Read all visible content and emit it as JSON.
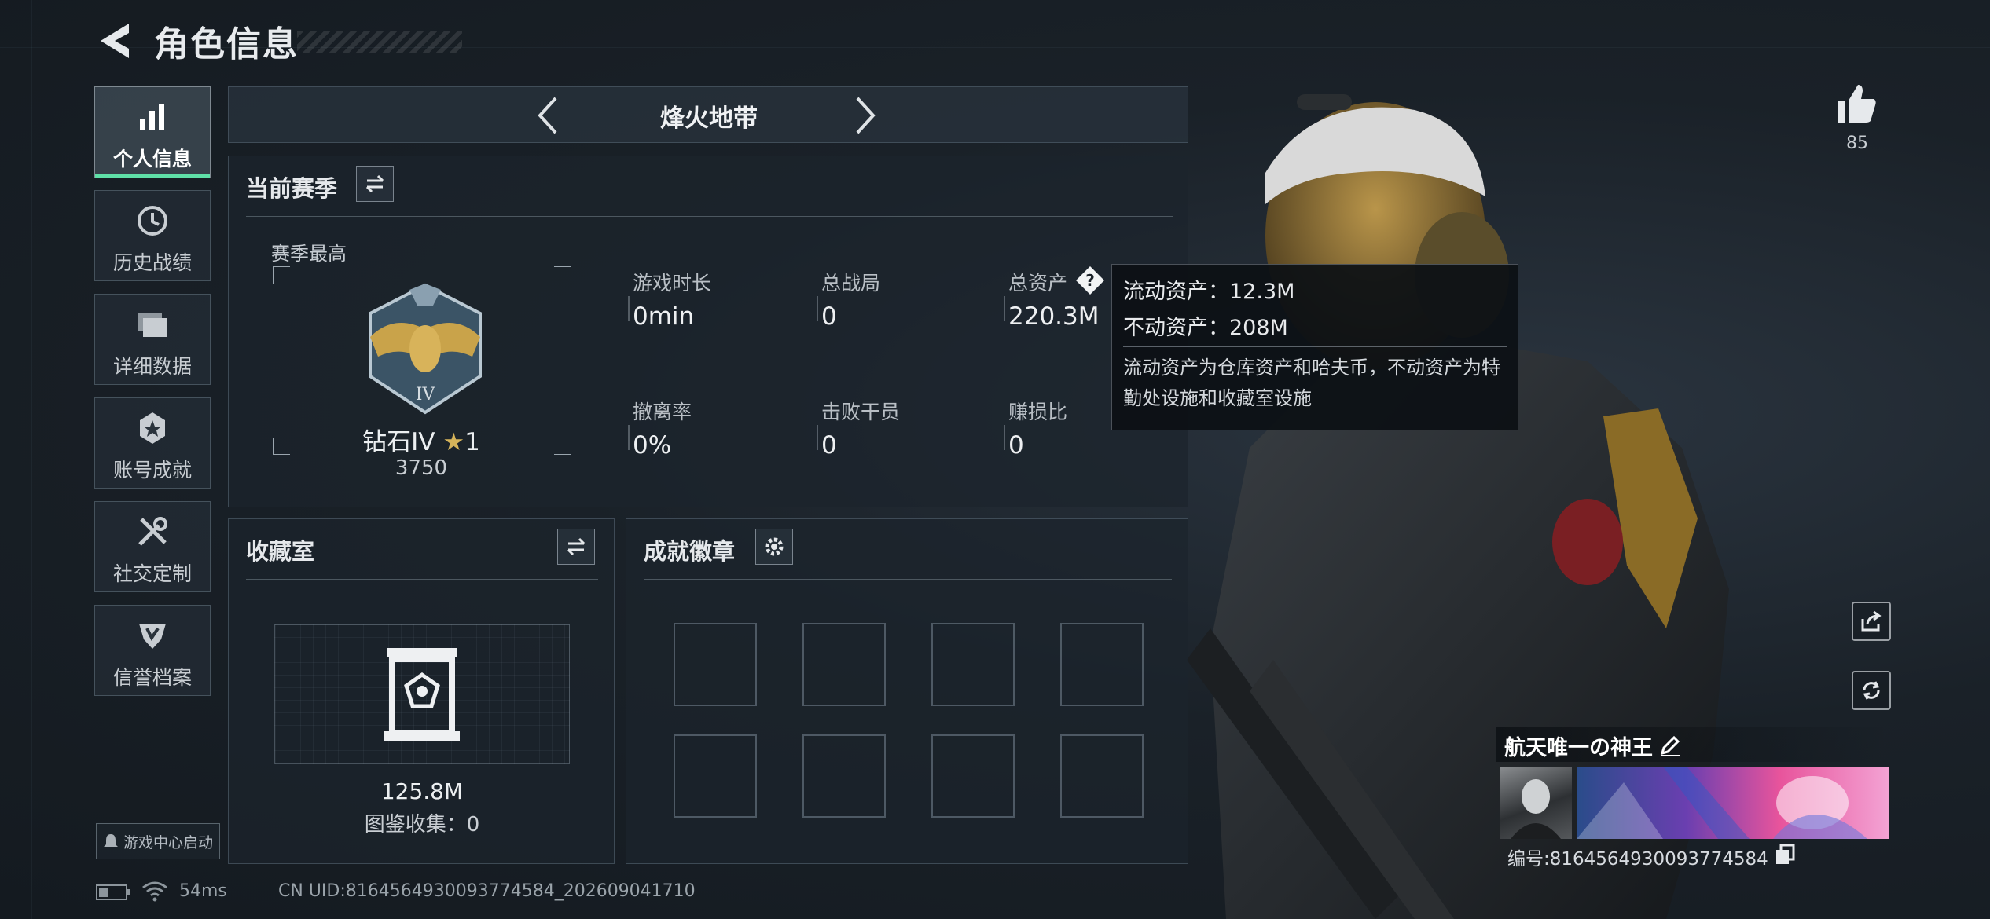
{
  "header": {
    "title": "角色信息"
  },
  "sidebar": {
    "items": [
      {
        "label": "个人信息",
        "icon": "bar-chart-icon",
        "active": true
      },
      {
        "label": "历史战绩",
        "icon": "clock-icon",
        "active": false
      },
      {
        "label": "详细数据",
        "icon": "folders-icon",
        "active": false
      },
      {
        "label": "账号成就",
        "icon": "medal-star-icon",
        "active": false
      },
      {
        "label": "社交定制",
        "icon": "wrench-screwdriver-icon",
        "active": false
      },
      {
        "label": "信誉档案",
        "icon": "shield-badge-icon",
        "active": false
      }
    ],
    "launch_label": "游戏中心启动"
  },
  "mode": {
    "title": "烽火地带"
  },
  "season": {
    "title": "当前赛季",
    "best_label": "赛季最高",
    "rank_name": "钻石IV",
    "rank_stars": "1",
    "rank_score": "3750",
    "stats": [
      {
        "label": "游戏时长",
        "value": "0min"
      },
      {
        "label": "总战局",
        "value": "0"
      },
      {
        "label": "总资产",
        "value": "220.3M"
      },
      {
        "label": "撤离率",
        "value": "0%"
      },
      {
        "label": "击败干员",
        "value": "0"
      },
      {
        "label": "赚损比",
        "value": "0"
      }
    ]
  },
  "tooltip": {
    "liquid": "流动资产：12.3M",
    "fixed": "不动资产：208M",
    "note": "流动资产为仓库资产和哈夫币，不动资产为特勤处设施和收藏室设施"
  },
  "collection": {
    "title": "收藏室",
    "value": "125.8M",
    "catalog": "图鉴收集：0"
  },
  "achievements": {
    "title": "成就徽章",
    "slots": 8
  },
  "profile": {
    "likes": "85",
    "name": "航天唯一の神王",
    "id_text": "编号:8164564930093774584"
  },
  "status": {
    "ping": "54ms",
    "uid": "CN UID:8164564930093774584_202609041710"
  },
  "colors": {
    "accent": "#5fe0a8",
    "gold": "#c9a34a",
    "panel": "#1c242c"
  }
}
